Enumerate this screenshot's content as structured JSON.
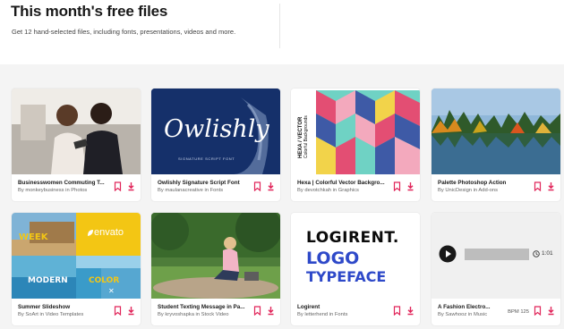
{
  "header": {
    "title": "This month's free files",
    "subtitle": "Get 12 hand-selected files, including fonts, presentations, videos and more."
  },
  "colors": {
    "accent": "#e1255a",
    "ink": "#191919",
    "muted": "#666666"
  },
  "cards": [
    {
      "name": "Businesswomen Commuting T...",
      "by": "By monkeybusiness in Photos",
      "icons": [
        "bookmark-icon",
        "download-icon"
      ]
    },
    {
      "name": "Owlishly Signature Script Font",
      "by": "By maulanacreative in Fonts",
      "thumb_text": "Owlishly",
      "thumb_small": "SIGNATURE SCRIPT FONT",
      "icons": [
        "bookmark-icon",
        "download-icon"
      ]
    },
    {
      "name": "Hexa | Colorful Vector Backgro...",
      "by": "By devotchkah in Graphics",
      "thumb_text": "HEXA / VECTOR",
      "thumb_text2": "Colorful Backgrounds",
      "icons": [
        "bookmark-icon",
        "download-icon"
      ]
    },
    {
      "name": "Palette Photoshop Action",
      "by": "By UnicDesign in Add-ons",
      "icons": [
        "bookmark-icon",
        "download-icon"
      ]
    },
    {
      "name": "Summer Slideshow",
      "by": "By SoArt in Video Templates",
      "thumb_text": "envato",
      "icons": [
        "bookmark-icon",
        "download-icon"
      ]
    },
    {
      "name": "Student Texting Message in Pa...",
      "by": "By kryvoshapka in Stock Video",
      "icons": [
        "bookmark-icon",
        "download-icon"
      ]
    },
    {
      "name": "Logirent",
      "by": "By letterhend in Fonts",
      "thumb_lines": [
        "LOGIRENT.",
        "LOGO",
        "TYPEFACE"
      ],
      "icons": [
        "bookmark-icon",
        "download-icon"
      ]
    },
    {
      "name": "A Fashion Electro...",
      "by": "By Sawhooz in Music",
      "bpm": "BPM 125",
      "duration": "1:01",
      "icons": [
        "bookmark-icon",
        "download-icon"
      ]
    }
  ]
}
